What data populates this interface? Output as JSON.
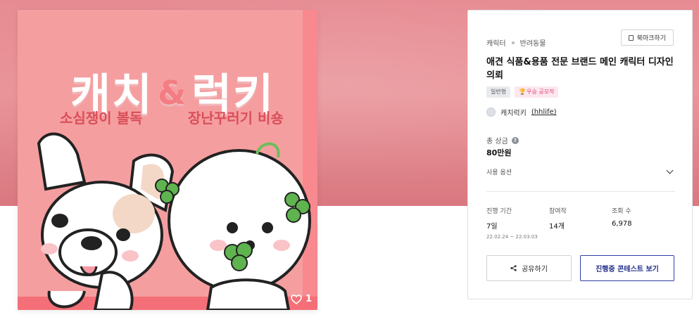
{
  "artwork": {
    "title_left": "캐치",
    "title_amp": "&",
    "title_right": "럭키",
    "subtitle_left": "소심쟁이 볼독",
    "subtitle_right": "장난꾸러기 비숑",
    "likes_count": "1"
  },
  "card": {
    "breadcrumb": [
      "캐릭터",
      "반려동물"
    ],
    "bookmark_label": "북마크하기",
    "title": "애견 식품&용품 전문 브랜드 메인 캐릭터 디자인 의뢰",
    "tags": {
      "general": "일반형",
      "award": "우승 공모작"
    },
    "host": {
      "name": "캐치럭키",
      "handle": "(hhlife)"
    },
    "prize": {
      "label": "총 상금",
      "value": "80만원"
    },
    "usage_label": "사용 옵션",
    "stats": {
      "period_label": "진행 기간",
      "period_value": "7일",
      "period_dates": "22.02.24 ~ 22.03.03",
      "entries_label": "참여작",
      "entries_value": "14개",
      "views_label": "조회 수",
      "views_value": "6,978"
    },
    "share_label": "공유하기",
    "view_contest_label": "진행중 콘테스트 보기"
  },
  "colors": {
    "hero_bg": "#e68b92",
    "artwork_bg": "#f59ea0",
    "primary_button": "#1f2d8a",
    "award_tag": "#e0457b"
  },
  "icons": {
    "bookmark": "bookmark-icon",
    "trophy": "trophy-icon",
    "help": "help-icon",
    "chevron": "chevron-down-icon",
    "share": "share-icon",
    "heart": "heart-icon"
  }
}
